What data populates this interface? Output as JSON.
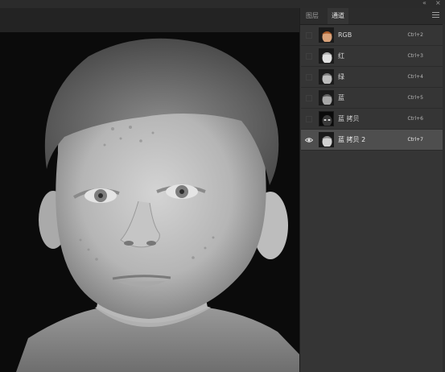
{
  "window": {
    "controls": [
      "«",
      "×"
    ]
  },
  "panel": {
    "tabs": [
      {
        "label": "图层",
        "active": false
      },
      {
        "label": "通道",
        "active": true
      }
    ],
    "channels": [
      {
        "name": "RGB",
        "shortcut": "Ctrl+2",
        "visible": false,
        "selected": false,
        "thumb": "color"
      },
      {
        "name": "红",
        "shortcut": "Ctrl+3",
        "visible": false,
        "selected": false,
        "thumb": "gray-light"
      },
      {
        "name": "绿",
        "shortcut": "Ctrl+4",
        "visible": false,
        "selected": false,
        "thumb": "gray-mid"
      },
      {
        "name": "蓝",
        "shortcut": "Ctrl+5",
        "visible": false,
        "selected": false,
        "thumb": "gray-dark"
      },
      {
        "name": "蓝 拷贝",
        "shortcut": "Ctrl+6",
        "visible": false,
        "selected": false,
        "thumb": "dark"
      },
      {
        "name": "蓝 拷贝 2",
        "shortcut": "Ctrl+7",
        "visible": true,
        "selected": true,
        "thumb": "gray-light"
      }
    ]
  },
  "colors": {
    "panel_bg": "#353535",
    "selected_row": "#4e4e4e",
    "canvas_bg": "#0d0d0d"
  },
  "icons": {
    "eye": "eye-icon",
    "menu": "panel-menu-icon"
  }
}
